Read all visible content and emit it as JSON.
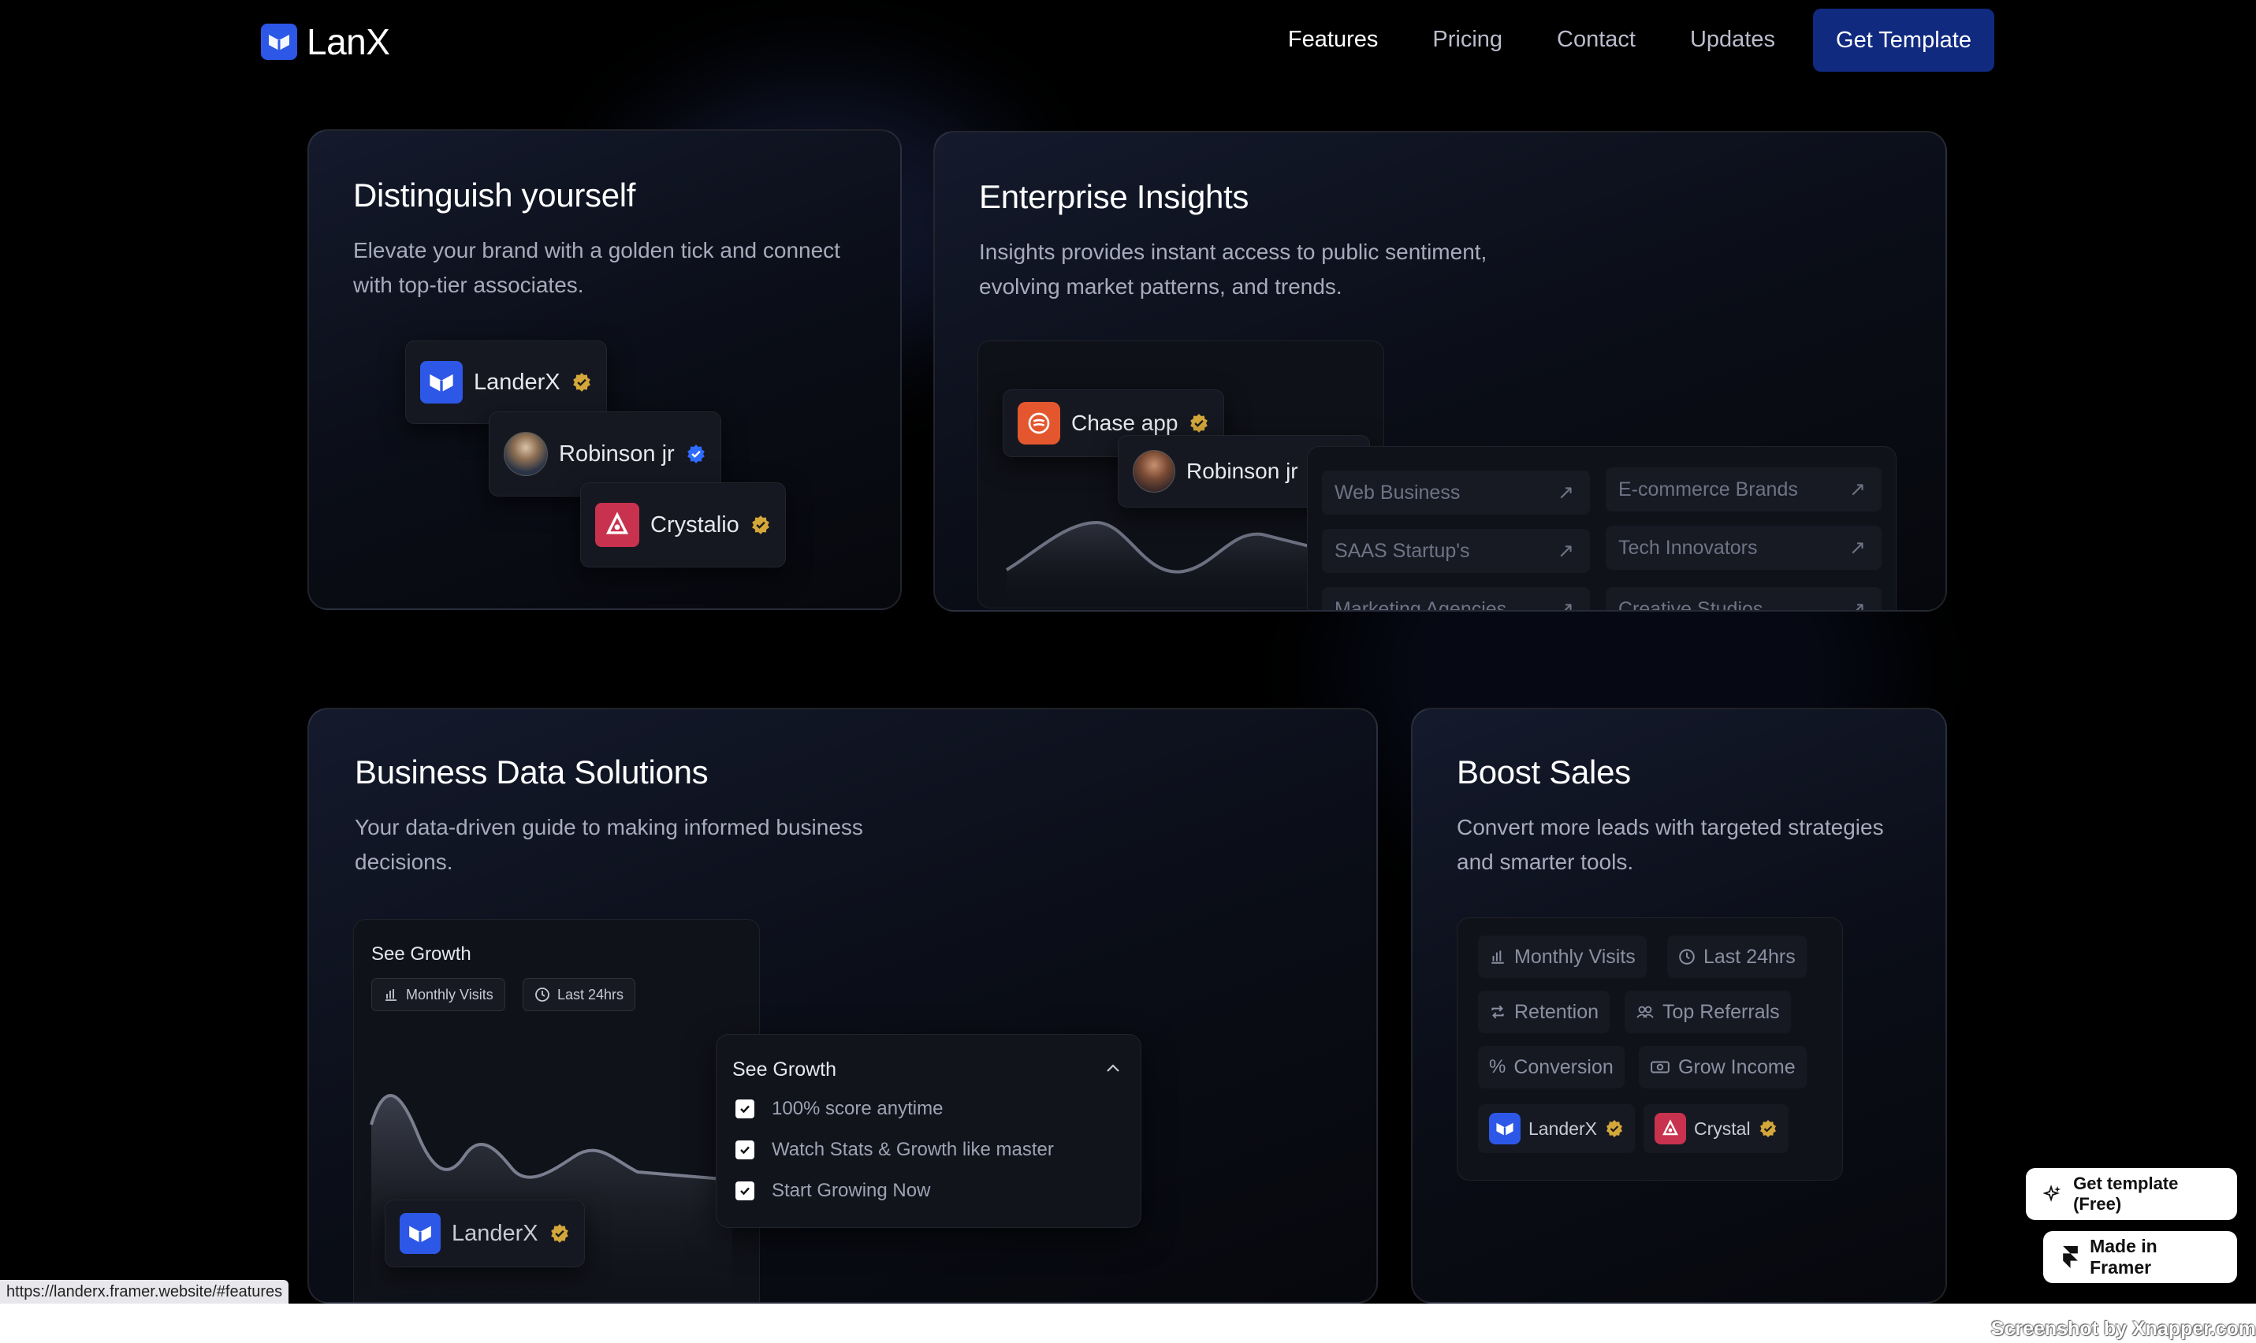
{
  "nav": {
    "logo_text": "LanX",
    "links": [
      "Features",
      "Pricing",
      "Contact",
      "Updates"
    ],
    "cta": "Get Template"
  },
  "distinguish": {
    "title": "Distinguish yourself",
    "desc_line1": "Elevate your brand with a golden tick and connect",
    "desc_line2": "with top-tier associates.",
    "chips": [
      "LanderX",
      "Robinson jr",
      "Crystalio"
    ]
  },
  "enterprise": {
    "title": "Enterprise Insights",
    "desc_line1": "Insights provides instant access to public sentiment,",
    "desc_line2": "evolving market patterns, and trends.",
    "chip_chase": "Chase app",
    "chip_robinson": "Robinson jr",
    "tags": [
      "Web Business",
      "E-commerce Brands",
      "SAAS Startup's",
      "Tech Innovators",
      "Marketing Agencies",
      "Creative Studios"
    ]
  },
  "business": {
    "title": "Business Data Solutions",
    "desc_line1": "Your data-driven guide to making informed business",
    "desc_line2": "decisions.",
    "growth_title": "See Growth",
    "chip_visits": "Monthly Visits",
    "chip_time": "Last 24hrs",
    "brand": "LanderX",
    "popup_title": "See Growth",
    "checklist": [
      "100% score anytime",
      "Watch Stats & Growth like master",
      "Start Growing Now"
    ]
  },
  "boost": {
    "title": "Boost Sales",
    "desc_line1": "Convert more leads with targeted strategies",
    "desc_line2": "and smarter tools.",
    "chips": [
      "Monthly Visits",
      "Last 24hrs",
      "Retention",
      "Top Referrals",
      "Conversion",
      "Grow Income"
    ],
    "brands": [
      "LanderX",
      "Crystal"
    ]
  },
  "floating": {
    "get_template": "Get template (Free)",
    "made_in": "Made in Framer"
  },
  "status_url": "https://landerx.framer.website/#features",
  "watermark": "Screenshot by Xnapper.com",
  "colors": {
    "accent_blue": "#2d57e6",
    "cta_blue": "#102a80",
    "gold_tick": "#d4a73b",
    "blue_tick": "#2f6bff",
    "chase_orange": "#e4572e",
    "crystal_red": "#c8324e"
  }
}
